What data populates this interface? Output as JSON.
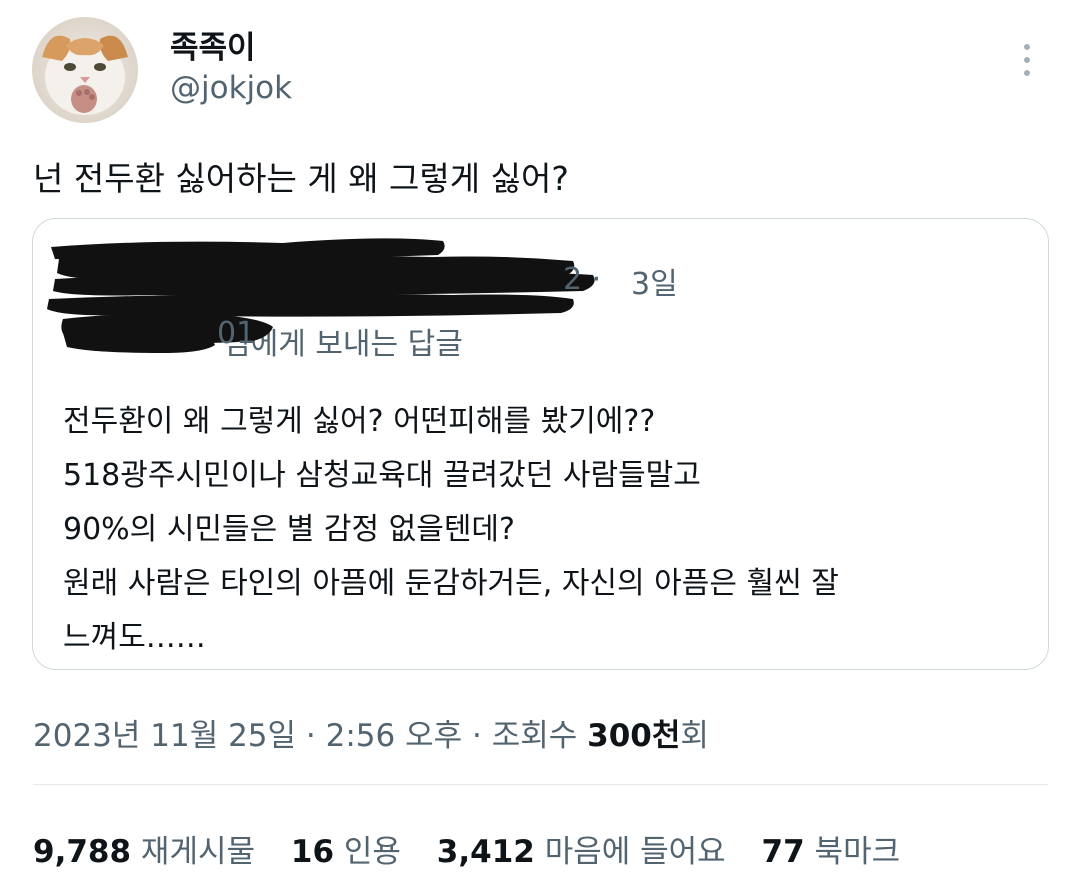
{
  "author": {
    "display_name": "족족이",
    "handle": "@jokjok"
  },
  "tweet": {
    "text": "넌 전두환 싫어하는 게 왜 그렇게 싫어?"
  },
  "quoted_tweet": {
    "time": "3일",
    "replying_to": "님에게 보내는 답글",
    "lines": [
      "전두환이 왜 그렇게 싫어? 어떤피해를 봤기에??",
      "518광주시민이나 삼청교육대 끌려갔던 사람들말고",
      "90%의 시민들은 별 감정 없을텐데?",
      "원래 사람은 타인의 아픔에 둔감하거든, 자신의 아픔은 훨씬 잘",
      "느껴도……"
    ]
  },
  "meta": {
    "date": "2023년 11월 25일",
    "separator": "·",
    "time": "2:56 오후",
    "views_label": "조회수",
    "views_count": "300천",
    "views_suffix": "회"
  },
  "stats": {
    "retweets_count": "9,788",
    "retweets_label": "재게시물",
    "quotes_count": "16",
    "quotes_label": "인용",
    "likes_count": "3,412",
    "likes_label": "마음에 들어요",
    "bookmarks_count": "77",
    "bookmarks_label": "북마크"
  },
  "colors": {
    "text_primary": "#0f1419",
    "text_secondary": "#536471",
    "border": "#cfd9de",
    "redaction": "#111111"
  },
  "icons": {
    "more": "more-vertical-icon"
  }
}
